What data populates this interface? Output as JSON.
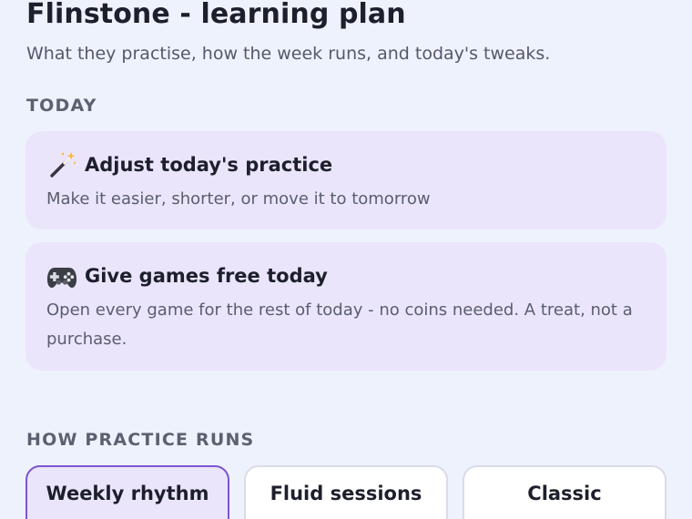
{
  "header": {
    "title": "Flinstone - learning plan",
    "subtitle": "What they practise, how the week runs, and today's tweaks."
  },
  "today": {
    "label": "TODAY",
    "cards": [
      {
        "icon": "magic-wand-icon",
        "title": "Adjust today's practice",
        "description": "Make it easier, shorter, or move it to tomorrow"
      },
      {
        "icon": "game-controller-icon",
        "title": "Give games free today",
        "description": "Open every game for the rest of today - no coins needed. A treat, not a purchase."
      }
    ]
  },
  "practice": {
    "label": "HOW PRACTICE RUNS",
    "options": [
      {
        "label": "Weekly rhythm",
        "selected": true
      },
      {
        "label": "Fluid sessions",
        "selected": false
      },
      {
        "label": "Classic",
        "selected": false
      }
    ]
  },
  "colors": {
    "background": "#eef2fc",
    "card": "#ebe5fc",
    "accent": "#7b55cf"
  }
}
